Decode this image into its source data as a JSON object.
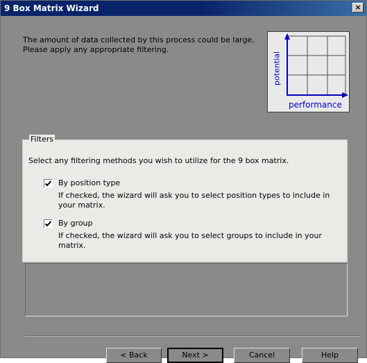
{
  "window": {
    "title": "9 Box Matrix Wizard",
    "close_glyph": "×"
  },
  "intro": {
    "line1": "The amount of data collected by this process could be large.",
    "line2": "Please apply any appropriate filtering."
  },
  "matrix_graphic": {
    "y_label": "potential",
    "x_label": "performance",
    "rows": 3,
    "cols": 3
  },
  "filters": {
    "legend": "Filters",
    "description": "Select any filtering methods you wish to utilize for the 9 box matrix.",
    "options": [
      {
        "label": "By position type",
        "checked": true,
        "help": "If checked, the wizard will ask you to select position types to include in your matrix."
      },
      {
        "label": "By group",
        "checked": true,
        "help": "If checked, the wizard will ask you to select groups to include in your matrix."
      }
    ]
  },
  "buttons": {
    "back": "< Back",
    "next": "Next >",
    "cancel": "Cancel",
    "help": "Help"
  },
  "colors": {
    "title_bar": "#0a246a",
    "client_bg": "#8a8a8a",
    "filters_bg": "#eceae6",
    "axis_blue": "#0000c0"
  }
}
